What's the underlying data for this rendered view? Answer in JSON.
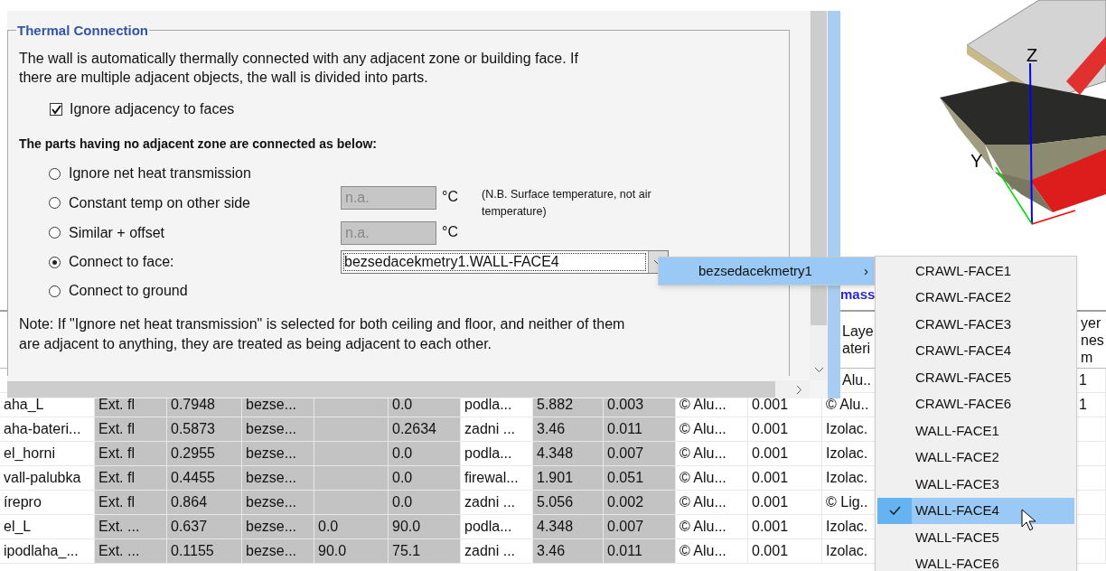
{
  "dialog": {
    "group_title": "Thermal Connection",
    "description": "The wall is automatically thermally connected with any adjacent zone or building face. If there are multiple adjacent objects, the wall is divided into parts.",
    "ignore_adjacency": {
      "label": "Ignore adjacency to faces",
      "checked": true
    },
    "heading": "The parts having no adjacent zone are connected as below:",
    "options": [
      {
        "kind": "plain",
        "label": "Ignore net heat transmission",
        "selected": false
      },
      {
        "kind": "temp",
        "label": "Constant temp on other side",
        "selected": false,
        "value": "n.a.",
        "disabled": true,
        "unit": "°C",
        "note": "(N.B. Surface temperature, not air temperature)"
      },
      {
        "kind": "temp",
        "label": "Similar + offset",
        "selected": false,
        "value": "n.a.",
        "disabled": true,
        "unit": "°C"
      },
      {
        "kind": "face",
        "label": "Connect to face:",
        "selected": true,
        "value": "bezsedacekmetry1.WALL-FACE4",
        "expanded": true
      },
      {
        "kind": "plain",
        "label": "Connect to ground",
        "selected": false
      }
    ],
    "note": "Note: If \"Ignore net heat transmission\" is selected for both ceiling and floor, and neither of them are adjacent to anything, they are treated as being adjacent to each other."
  },
  "menu": {
    "parent": "bezsedacekmetry1",
    "arrow": "›",
    "items": [
      {
        "label": "CRAWL-FACE1",
        "checked": false
      },
      {
        "label": "CRAWL-FACE2",
        "checked": false
      },
      {
        "label": "CRAWL-FACE3",
        "checked": false
      },
      {
        "label": "CRAWL-FACE4",
        "checked": false
      },
      {
        "label": "CRAWL-FACE5",
        "checked": false
      },
      {
        "label": "CRAWL-FACE6",
        "checked": false
      },
      {
        "label": "WALL-FACE1",
        "checked": false
      },
      {
        "label": "WALL-FACE2",
        "checked": false
      },
      {
        "label": "WALL-FACE3",
        "checked": false
      },
      {
        "label": "WALL-FACE4",
        "checked": true
      },
      {
        "label": "WALL-FACE5",
        "checked": false
      },
      {
        "label": "WALL-FACE6",
        "checked": false
      }
    ]
  },
  "view3d": {
    "axes": [
      "Z",
      "Y"
    ]
  },
  "tab_label": "mass",
  "table": {
    "columns": [
      {
        "shaded": false
      },
      {
        "shaded": true
      },
      {
        "shaded": true
      },
      {
        "shaded": true
      },
      {
        "shaded": true
      },
      {
        "shaded": true
      },
      {
        "shaded": false
      },
      {
        "shaded": true
      },
      {
        "shaded": true
      },
      {
        "shaded": false
      },
      {
        "shaded": false
      },
      {
        "shaded": false,
        "header": [
          "Laye",
          "ateri"
        ]
      },
      {
        "shaded": false,
        "header": [
          "yer",
          "nes",
          "m"
        ]
      }
    ],
    "rows": [
      [
        null,
        null,
        null,
        null,
        null,
        null,
        null,
        null,
        null,
        null,
        null,
        "Alu..",
        "1"
      ],
      [
        "aha_L",
        "Ext. fl",
        "0.7948",
        "bezse...",
        null,
        "0.0",
        "podla...",
        "5.882",
        "0.003",
        "© Alu...",
        "0.001",
        "© Alu..",
        "1"
      ],
      [
        "aha-bateri...",
        "Ext. fl",
        "0.5873",
        "bezse...",
        null,
        "0.2634",
        "zadni ...",
        "3.46",
        "0.011",
        "© Alu...",
        "0.001",
        "Izolac.",
        null
      ],
      [
        "el_horni",
        "Ext. fl",
        "0.2955",
        "bezse...",
        null,
        "0.0",
        "podla...",
        "4.348",
        "0.007",
        "© Alu...",
        "0.001",
        "Izolac.",
        null
      ],
      [
        "vall-palubka",
        "Ext. fl",
        "0.4455",
        "bezse...",
        null,
        "0.0",
        "firewal...",
        "1.901",
        "0.051",
        "© Alu...",
        "0.001",
        "Izolac.",
        null
      ],
      [
        "írepro",
        "Ext. fl",
        "0.864",
        "bezse...",
        null,
        "0.0",
        "zadni ...",
        "5.056",
        "0.002",
        "© Alu...",
        "0.001",
        "© Lig..",
        null
      ],
      [
        "el_L",
        "Ext. ...",
        "0.637",
        "bezse...",
        "0.0",
        "90.0",
        "podla...",
        "4.348",
        "0.007",
        "© Alu...",
        "0.001",
        "Izolac.",
        null
      ],
      [
        "ipodlaha_...",
        "Ext. ...",
        "0.1155",
        "bezse...",
        "90.0",
        "75.1",
        "zadni ...",
        "3.46",
        "0.011",
        "© Alu...",
        "0.001",
        "Izolac.",
        null
      ]
    ]
  }
}
